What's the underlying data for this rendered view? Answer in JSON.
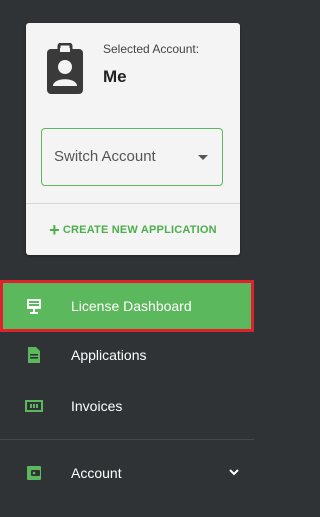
{
  "account": {
    "selected_label": "Selected Account:",
    "selected_value": "Me",
    "switch_placeholder": "Switch Account",
    "create_label": "CREATE NEW APPLICATION"
  },
  "nav": {
    "items": [
      {
        "label": "License Dashboard",
        "icon": "monitor-icon",
        "active": true
      },
      {
        "label": "Applications",
        "icon": "document-icon",
        "active": false
      },
      {
        "label": "Invoices",
        "icon": "banknote-icon",
        "active": false
      },
      {
        "label": "Account",
        "icon": "wallet-icon",
        "active": false
      }
    ]
  },
  "colors": {
    "sidebar_bg": "#2f3335",
    "accent_green": "#5cb85c",
    "active_outline": "#e0202a",
    "card_bg": "#f4f4f4"
  }
}
